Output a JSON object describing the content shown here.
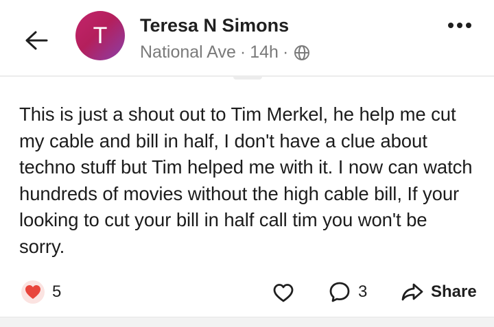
{
  "header": {
    "avatar_initial": "T",
    "author_name": "Teresa N Simons",
    "location": "National Ave",
    "separator": "·",
    "time_ago": "14h",
    "icons": {
      "back": "arrow-left-icon",
      "privacy": "globe-icon",
      "more": "more-horizontal-icon"
    }
  },
  "post": {
    "body": "This is just a shout out to Tim Merkel, he help me cut my cable and bill in half, I don't have a clue about techno stuff but Tim helped me with it. I now can watch hundreds of movies without the high cable bill, If your looking to cut your bill in half call tim you won't be sorry."
  },
  "footer": {
    "reaction_icon": "heart-reaction-icon",
    "reaction_count": "5",
    "like_icon": "heart-outline-icon",
    "comment_icon": "comment-icon",
    "comment_count": "3",
    "share_icon": "share-icon",
    "share_label": "Share"
  },
  "colors": {
    "avatar_gradient_start": "#c2256b",
    "avatar_gradient_end": "#8a3fa8",
    "reaction_heart": "#e8453c",
    "meta_text": "#7a7a7a"
  }
}
